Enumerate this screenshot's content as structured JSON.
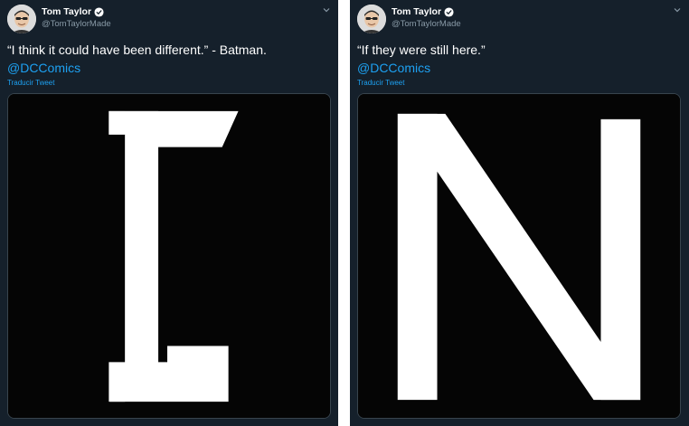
{
  "tweets": [
    {
      "author_name": "Tom Taylor",
      "handle": "@TomTaylorMade",
      "text": "“I think it could have been different.” - Batman.",
      "mention": "@DCComics",
      "translate_label": "Traducir Tweet",
      "media_letter": "I",
      "verified_icon": "verified-badge-icon",
      "menu_icon": "chevron-down-icon"
    },
    {
      "author_name": "Tom Taylor",
      "handle": "@TomTaylorMade",
      "text": "“If they were still here.”",
      "mention": "@DCComics",
      "translate_label": "Traducir Tweet",
      "media_letter": "N",
      "verified_icon": "verified-badge-icon",
      "menu_icon": "chevron-down-icon"
    }
  ],
  "colors": {
    "background": "#15202b",
    "text": "#ffffff",
    "secondary_text": "#8899a6",
    "link": "#1da1f2",
    "media_background": "#050505",
    "letter": "#ffffff"
  }
}
